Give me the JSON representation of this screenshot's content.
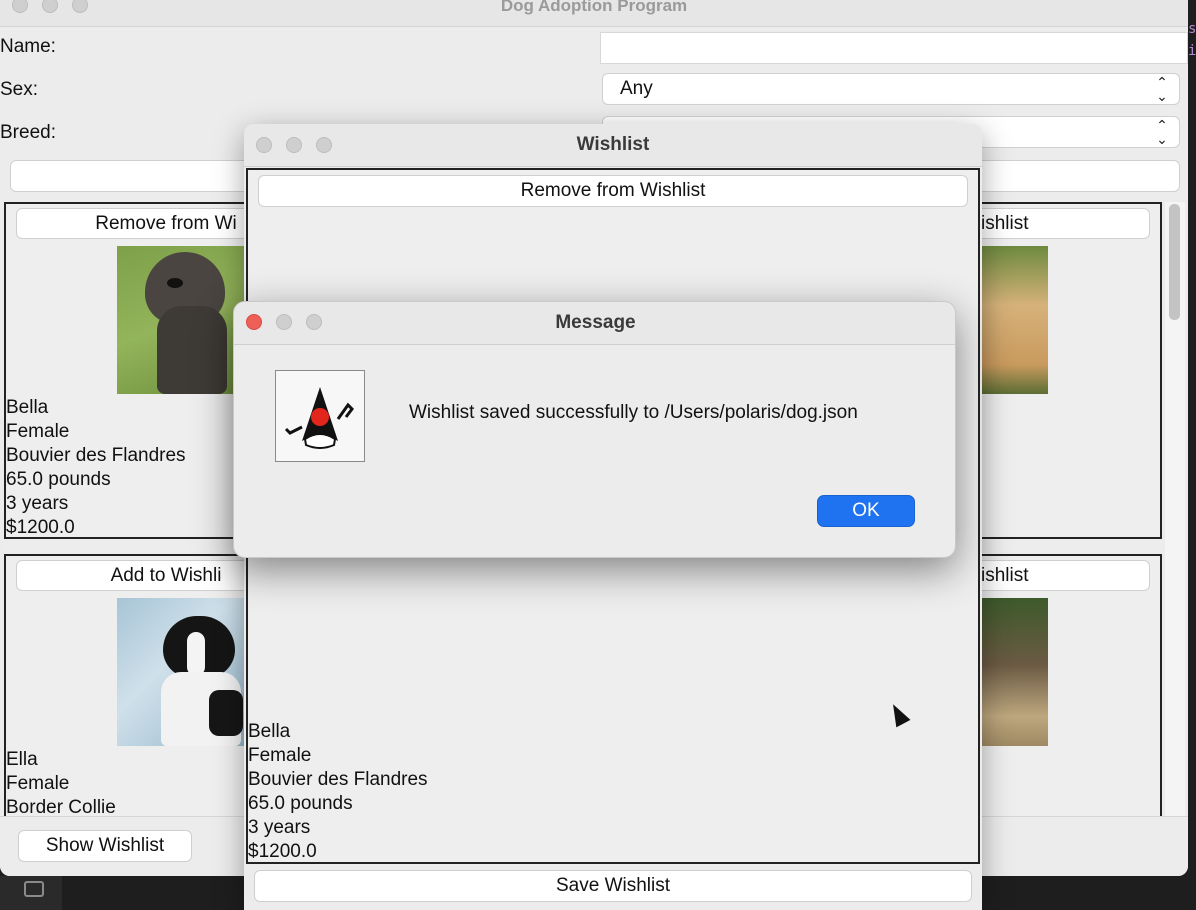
{
  "main_window": {
    "title": "Dog Adoption Program",
    "form": {
      "name_label": "Name:",
      "name_value": "",
      "sex_label": "Sex:",
      "sex_selected": "Any",
      "breed_label": "Breed:",
      "breed_selected": ""
    },
    "cards": [
      {
        "button_label": "Remove from Wi",
        "name": "Bella",
        "sex": "Female",
        "breed": "Bouvier des Flandres",
        "weight": "65.0 pounds",
        "age": "3 years",
        "price": "$1200.0"
      },
      {
        "button_label": "ishlist"
      },
      {
        "button_label": "Add to Wishli",
        "name": "Ella",
        "sex": "Female",
        "breed": "Border Collie"
      },
      {
        "button_label": "ishlist"
      }
    ],
    "show_wishlist_label": "Show Wishlist"
  },
  "wishlist_window": {
    "title": "Wishlist",
    "remove_label": "Remove from Wishlist",
    "dog": {
      "name": "Bella",
      "sex": "Female",
      "breed": "Bouvier des Flandres",
      "weight": "65.0 pounds",
      "age": "3 years",
      "price": "$1200.0"
    },
    "save_label": "Save Wishlist"
  },
  "message_dialog": {
    "title": "Message",
    "message": "Wishlist saved successfully to /Users/polaris/dog.json",
    "ok_label": "OK",
    "icon": "java-duke-icon"
  },
  "colors": {
    "ok_blue": "#1f73f1",
    "close_red": "#ed5f57",
    "window_bg": "#ececec"
  }
}
